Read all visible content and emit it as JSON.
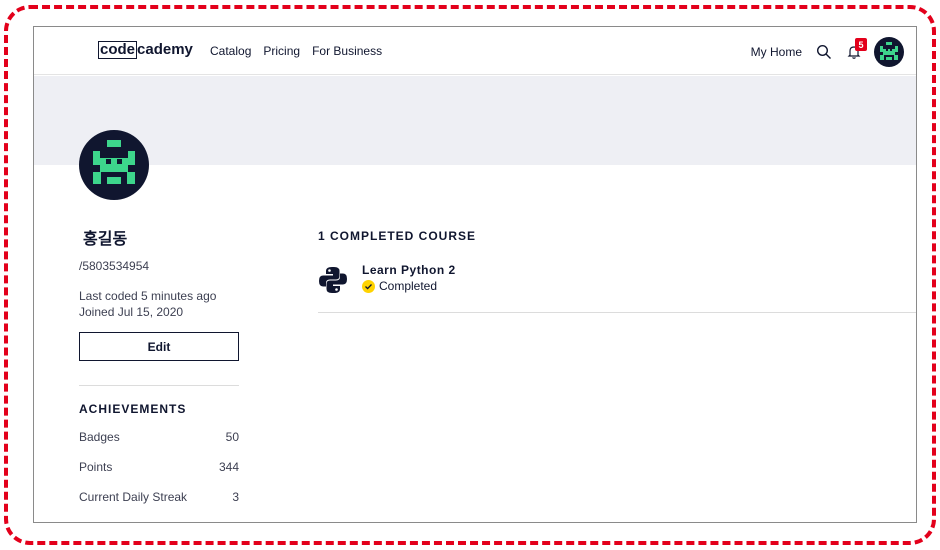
{
  "nav": {
    "logo_code": "code",
    "logo_rest": "cademy",
    "links": [
      "Catalog",
      "Pricing",
      "For Business"
    ],
    "my_home": "My Home",
    "notification_count": "5"
  },
  "profile": {
    "name": "홍길동",
    "user_id": "/5803534954",
    "last_coded": "Last coded 5 minutes ago",
    "joined": "Joined Jul 15, 2020",
    "edit_label": "Edit"
  },
  "achievements": {
    "title": "ACHIEVEMENTS",
    "rows": [
      {
        "label": "Badges",
        "value": "50"
      },
      {
        "label": "Points",
        "value": "344"
      },
      {
        "label": "Current Daily Streak",
        "value": "3"
      }
    ]
  },
  "courses": {
    "title": "1 COMPLETED COURSE",
    "items": [
      {
        "name": "Learn Python 2",
        "status": "Completed"
      }
    ]
  },
  "colors": {
    "frame": "#e3001b",
    "avatar_bg": "#10162f",
    "avatar_face": "#3dd68c",
    "badge": "#e3001b",
    "check": "#ffd300"
  }
}
